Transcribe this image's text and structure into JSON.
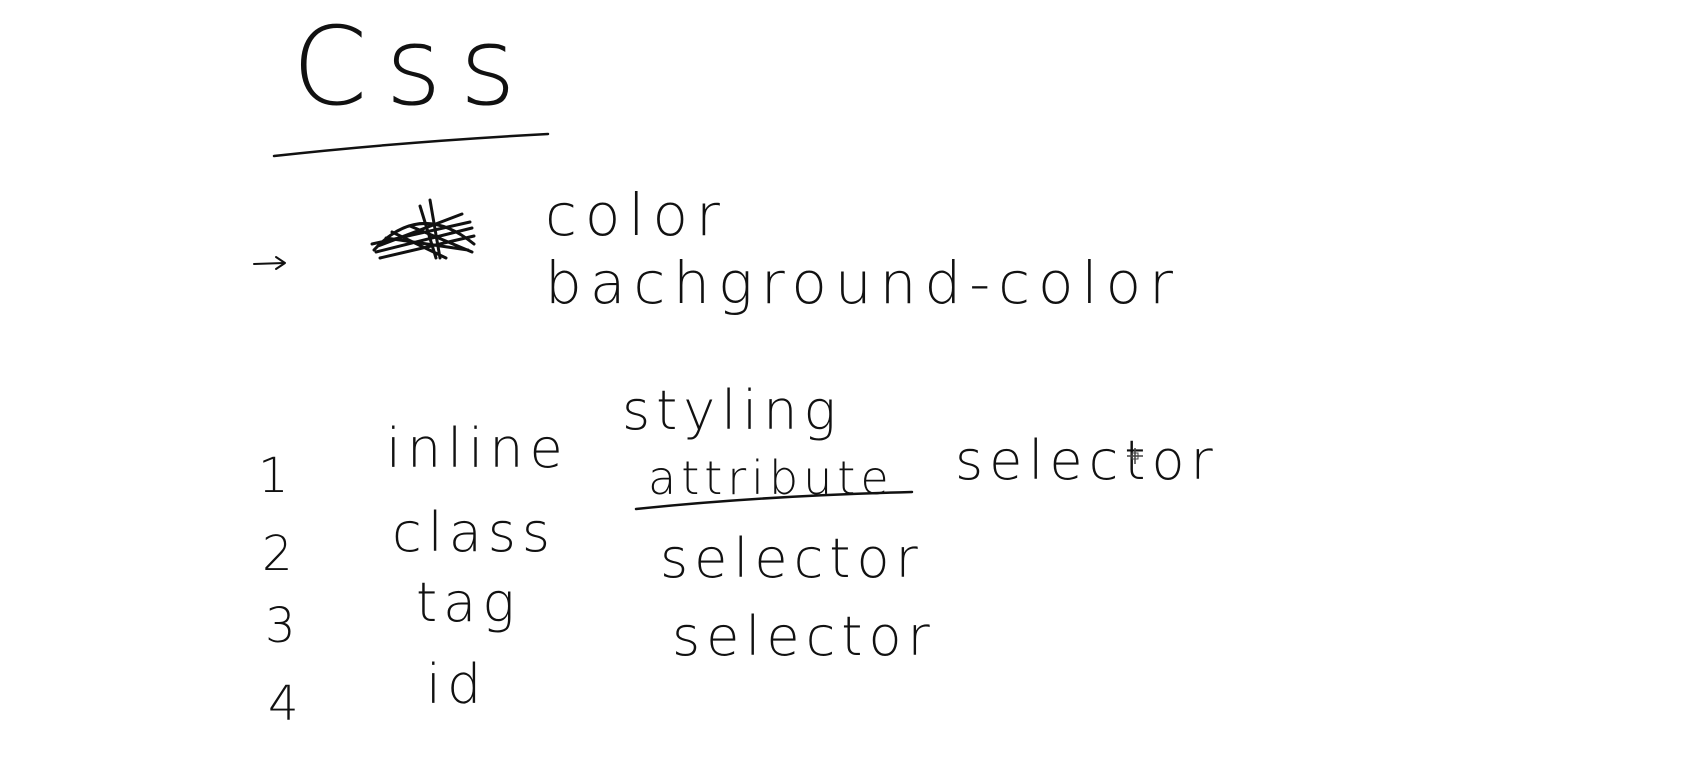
{
  "title": "Css",
  "properties": {
    "color": "color",
    "background_color": "bachground-color"
  },
  "rows": [
    {
      "num": "1",
      "word": "inline",
      "label": "styling",
      "struck": "attribute",
      "extra": "selector"
    },
    {
      "num": "2",
      "word": "class",
      "label": "selector"
    },
    {
      "num": "3",
      "word": "tag",
      "label": "selector"
    },
    {
      "num": "4",
      "word": "id"
    }
  ],
  "icons": {
    "arrow": "right-arrow-icon",
    "scribble": "scribble-icon",
    "cursor": "crosshair-cursor-icon"
  },
  "colors": {
    "ink": "#111111",
    "background": "#ffffff"
  }
}
